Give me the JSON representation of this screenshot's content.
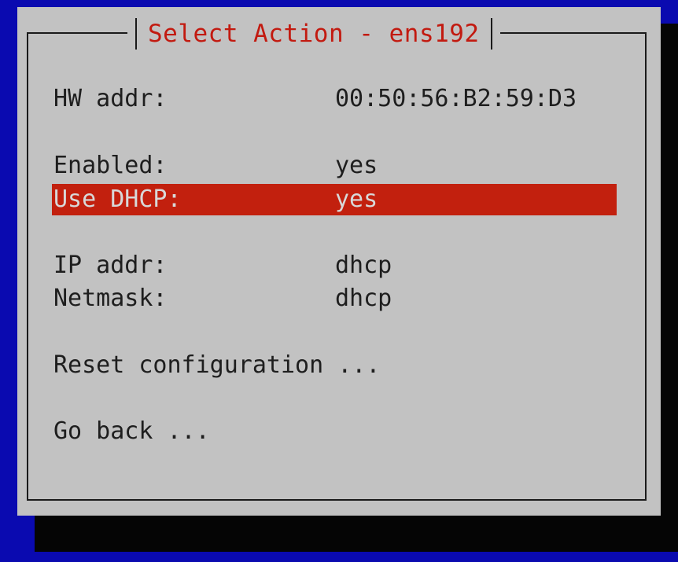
{
  "dialog": {
    "title": "Select Action - ens192"
  },
  "rows": {
    "hw_addr": {
      "label": "HW addr:",
      "value": "00:50:56:B2:59:D3"
    },
    "enabled": {
      "label": "Enabled:",
      "value": "yes"
    },
    "use_dhcp": {
      "label": "Use DHCP:",
      "value": "yes",
      "selected": true
    },
    "ip_addr": {
      "label": "IP addr:",
      "value": "dhcp"
    },
    "netmask": {
      "label": "Netmask:",
      "value": "dhcp"
    },
    "reset": {
      "label": "Reset configuration ..."
    },
    "go_back": {
      "label": "Go back ..."
    }
  },
  "colors": {
    "background": "#0a0ab0",
    "dialog": "#c2c2c2",
    "accent": "#c2200e",
    "text": "#1e1e1e",
    "selected_text": "#d8d8d8"
  }
}
